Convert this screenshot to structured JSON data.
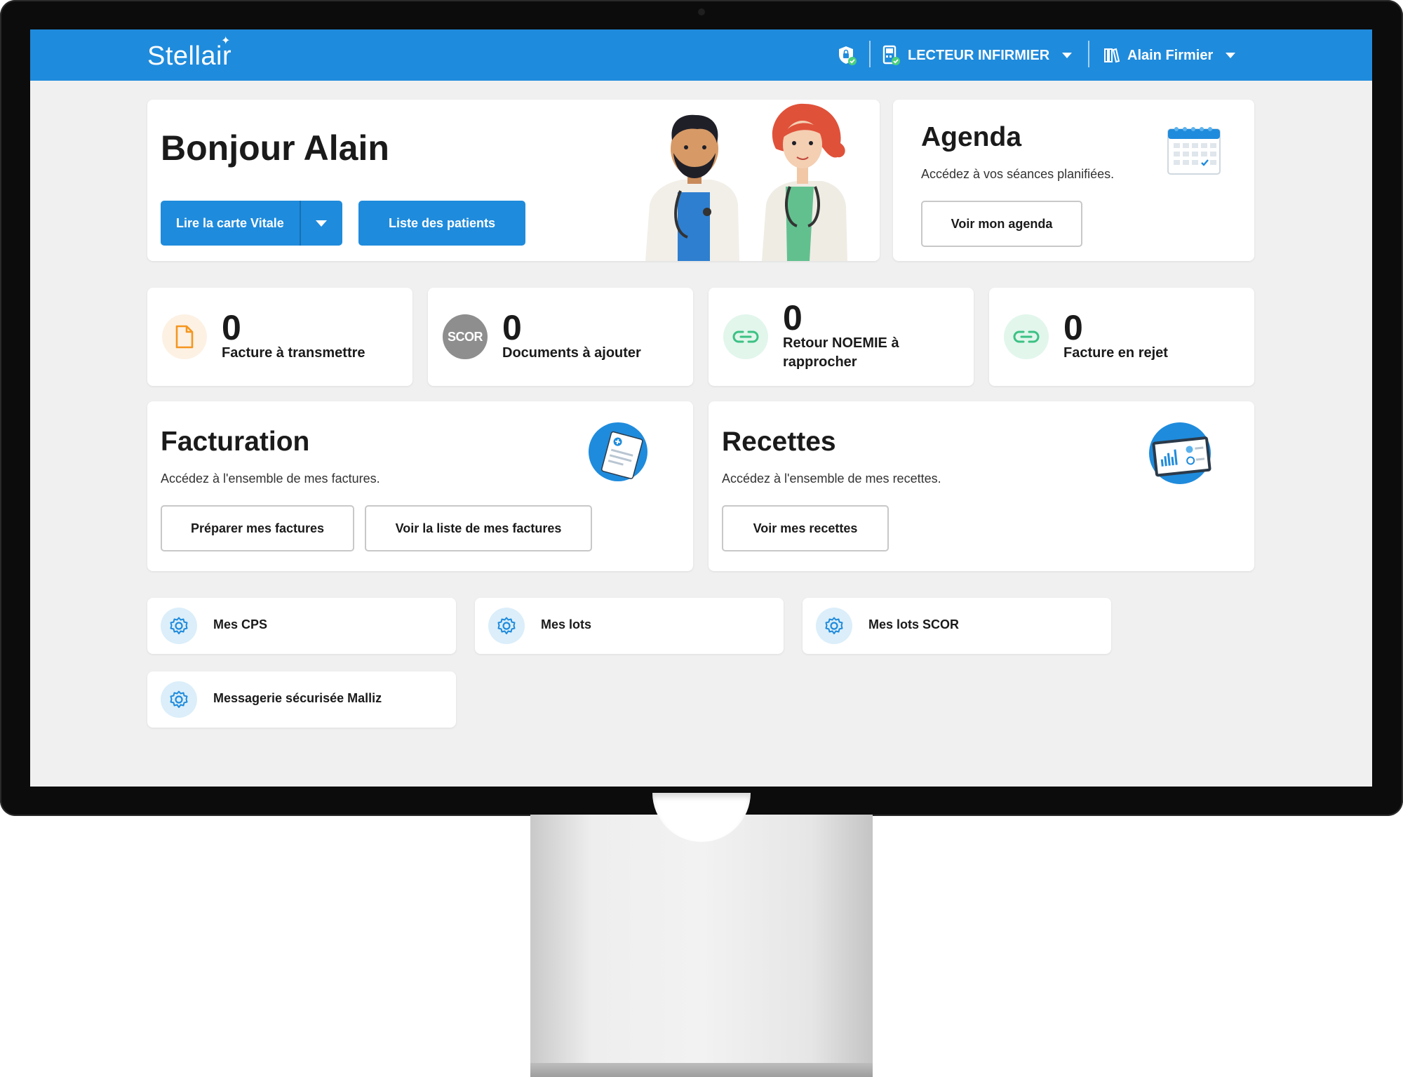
{
  "header": {
    "logo": "Stellair",
    "reader_label": "LECTEUR INFIRMIER",
    "user_name": "Alain Firmier",
    "brand_color": "#1f8bdc"
  },
  "welcome": {
    "greeting": "Bonjour Alain",
    "read_card_button": "Lire la carte Vitale",
    "patients_button": "Liste des patients"
  },
  "agenda": {
    "title": "Agenda",
    "description": "Accédez à vos séances planifiées.",
    "button": "Voir mon agenda"
  },
  "stats": [
    {
      "value": "0",
      "label": "Facture à transmettre",
      "icon": "document-icon"
    },
    {
      "value": "0",
      "label": "Documents à ajouter",
      "icon": "scor-icon",
      "icon_text": "SCOR"
    },
    {
      "value": "0",
      "label": "Retour NOEMIE à rapprocher",
      "icon": "link-icon"
    },
    {
      "value": "0",
      "label": "Facture en rejet",
      "icon": "link-icon"
    }
  ],
  "facturation": {
    "title": "Facturation",
    "description": "Accédez à l'ensemble de mes factures.",
    "prepare_button": "Préparer mes factures",
    "list_button": "Voir la liste de mes factures"
  },
  "recettes": {
    "title": "Recettes",
    "description": "Accédez à l'ensemble de mes recettes.",
    "button": "Voir mes recettes"
  },
  "quick_links": [
    {
      "label": "Mes CPS",
      "icon": "gear-icon"
    },
    {
      "label": "Mes lots",
      "icon": "gear-icon"
    },
    {
      "label": "Mes lots SCOR",
      "icon": "gear-icon"
    },
    {
      "label": "Messagerie sécurisée Malliz",
      "icon": "gear-icon"
    }
  ]
}
